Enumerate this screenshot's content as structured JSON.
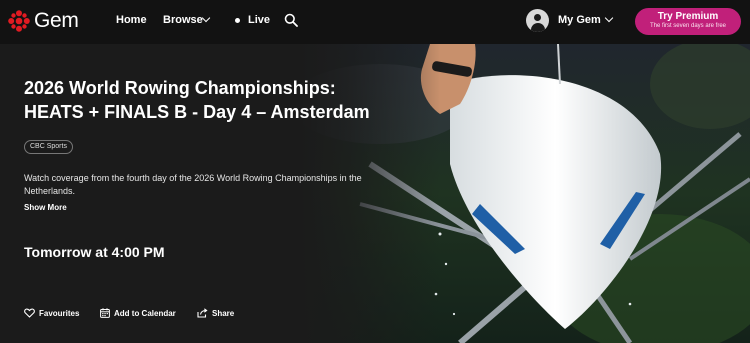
{
  "header": {
    "logo_text": "Gem",
    "nav": {
      "home": "Home",
      "browse": "Browse",
      "live": "Live"
    },
    "account_label": "My Gem",
    "premium": {
      "title": "Try Premium",
      "subtitle": "The first seven days are free"
    }
  },
  "hero": {
    "title_line1": "2026 World Rowing Championships:",
    "title_line2": "HEATS + FINALS B - Day 4 – Amsterdam",
    "network_badge": "CBC Sports",
    "description": "Watch coverage from the fourth day of the 2026 World Rowing Championships in the Netherlands.",
    "show_more": "Show More",
    "airtime": "Tomorrow at 4:00 PM",
    "actions": {
      "favourites": "Favourites",
      "calendar": "Add to Calendar",
      "share": "Share"
    }
  },
  "colors": {
    "background": "#151515",
    "premium_button": "#c1207a",
    "logo_red": "#e11b22"
  },
  "icons": [
    "cbc-logo-icon",
    "chevron-down-icon",
    "live-dot-icon",
    "search-icon",
    "avatar-icon",
    "heart-icon",
    "calendar-icon",
    "share-icon"
  ]
}
